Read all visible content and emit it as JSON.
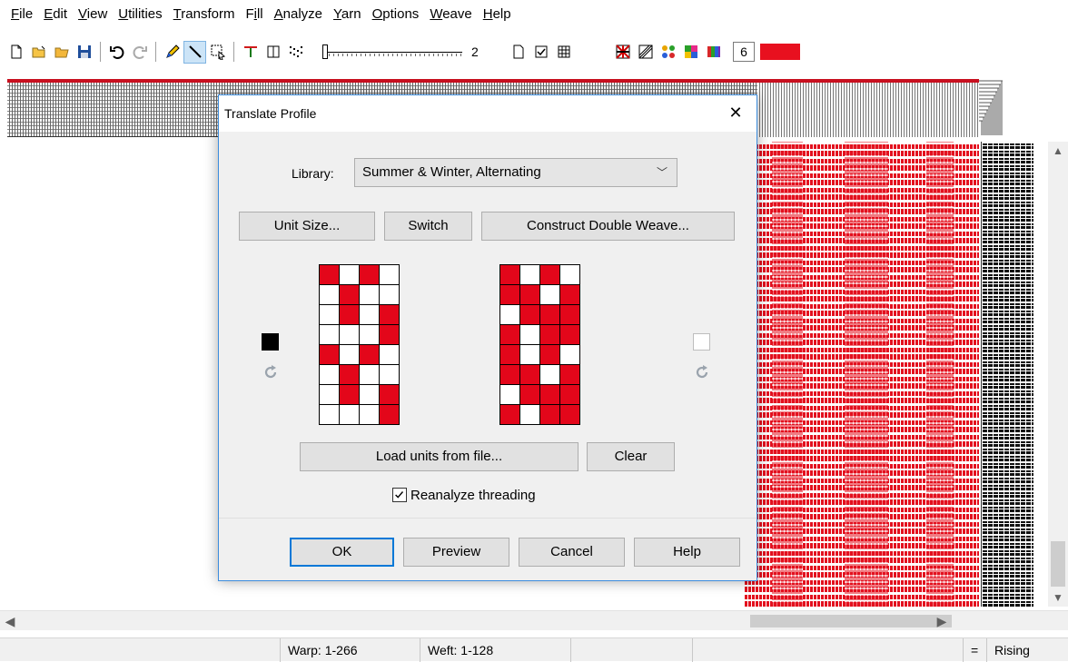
{
  "menu": [
    "File",
    "Edit",
    "View",
    "Utilities",
    "Transform",
    "Fill",
    "Analyze",
    "Yarn",
    "Options",
    "Weave",
    "Help"
  ],
  "menu_accel": [
    "F",
    "E",
    "V",
    "U",
    "T",
    "i",
    "A",
    "Y",
    "O",
    "W",
    "H"
  ],
  "toolbar": {
    "slider_value": "2",
    "color_number": "6",
    "current_color": "#e8101f",
    "icons": [
      "new-file-icon",
      "open-file-icon",
      "open-folder-icon",
      "save-icon",
      "undo-icon",
      "redo-icon",
      "pencil-icon",
      "line-icon",
      "select-icon",
      "treadle-icon",
      "book-icon",
      "dots-icon",
      "blank-page-icon",
      "checklist-icon",
      "grid-icon",
      "pattern-a-icon",
      "pattern-b-icon",
      "palette-dots-icon",
      "palette-grid-icon",
      "color-table-icon"
    ]
  },
  "dialog": {
    "title": "Translate Profile",
    "close_glyph": "✕",
    "library_label": "Library:",
    "library_value": "Summer & Winter, Alternating",
    "unit_size_button": "Unit Size...",
    "switch_button": "Switch",
    "construct_button": "Construct Double Weave...",
    "left_unit": [
      [
        1,
        0,
        1,
        0
      ],
      [
        0,
        1,
        0,
        0
      ],
      [
        0,
        1,
        0,
        1
      ],
      [
        0,
        0,
        0,
        1
      ],
      [
        1,
        0,
        1,
        0
      ],
      [
        0,
        1,
        0,
        0
      ],
      [
        0,
        1,
        0,
        1
      ],
      [
        0,
        0,
        0,
        1
      ]
    ],
    "right_unit": [
      [
        1,
        0,
        1,
        0
      ],
      [
        1,
        1,
        0,
        1
      ],
      [
        0,
        1,
        1,
        1
      ],
      [
        1,
        0,
        1,
        1
      ],
      [
        1,
        0,
        1,
        0
      ],
      [
        1,
        1,
        0,
        1
      ],
      [
        0,
        1,
        1,
        1
      ],
      [
        1,
        0,
        1,
        1
      ]
    ],
    "left_color": "#000000",
    "right_color": "#ffffff",
    "unit_color": "#e3061a",
    "load_button": "Load units from file...",
    "clear_button": "Clear",
    "reanalyze_label": "Reanalyze threading",
    "reanalyze_checked": true,
    "ok_button": "OK",
    "preview_button": "Preview",
    "cancel_button": "Cancel",
    "help_button": "Help"
  },
  "status": {
    "warp": "Warp: 1-266",
    "weft": "Weft: 1-128",
    "equals": "=",
    "mode": "Rising"
  },
  "colors": {
    "accent_red": "#e3101e",
    "dialog_border": "#3c8dde",
    "default_button_border": "#0078d7"
  }
}
